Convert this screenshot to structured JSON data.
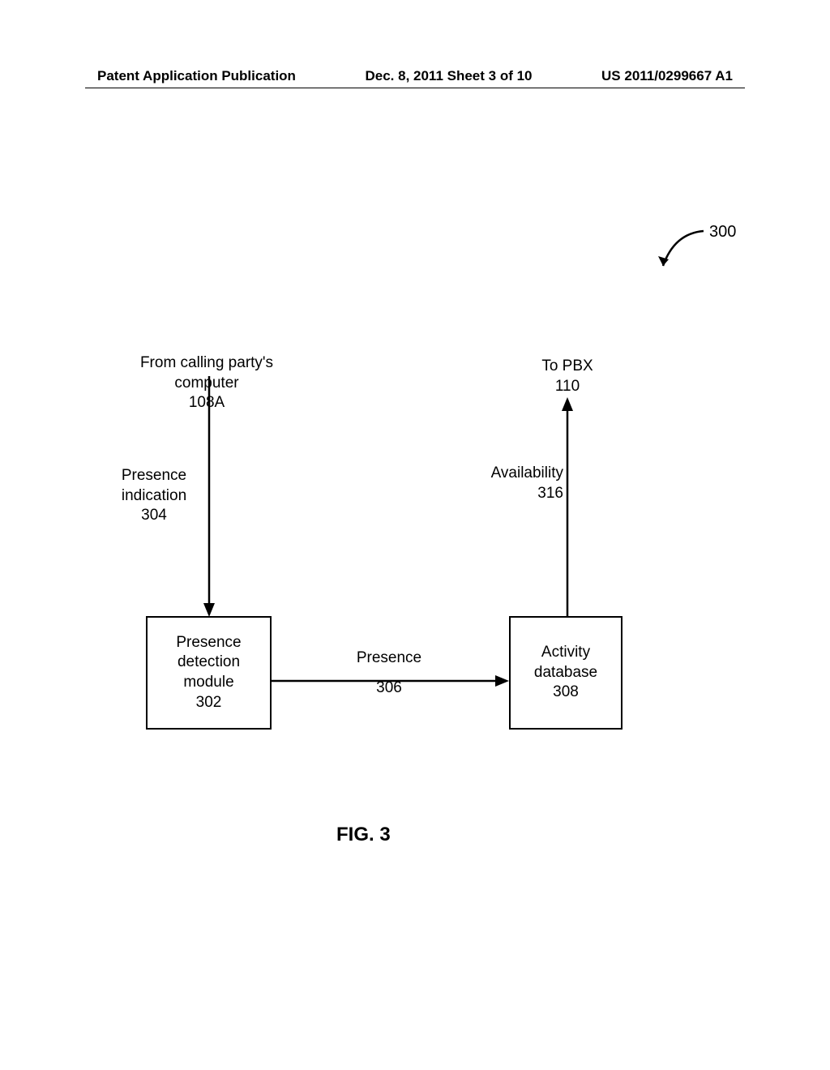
{
  "header": {
    "left": "Patent Application Publication",
    "center": "Dec. 8, 2011   Sheet 3 of 10",
    "right": "US 2011/0299667 A1"
  },
  "refnum_300": "300",
  "labels": {
    "from_computer_line1": "From calling party's",
    "from_computer_line2": "computer",
    "from_computer_line3": "108A",
    "presence_ind_line1": "Presence",
    "presence_ind_line2": "indication",
    "presence_ind_line3": "304",
    "to_pbx_line1": "To PBX",
    "to_pbx_line2": "110",
    "availability_line1": "Availability",
    "availability_line2": "316",
    "presence_line1": "Presence",
    "presence_line2": "306"
  },
  "boxes": {
    "presence_det_line1": "Presence",
    "presence_det_line2": "detection",
    "presence_det_line3": "module",
    "presence_det_line4": "302",
    "activity_db_line1": "Activity",
    "activity_db_line2": "database",
    "activity_db_line3": "308"
  },
  "figure_caption": "FIG. 3"
}
